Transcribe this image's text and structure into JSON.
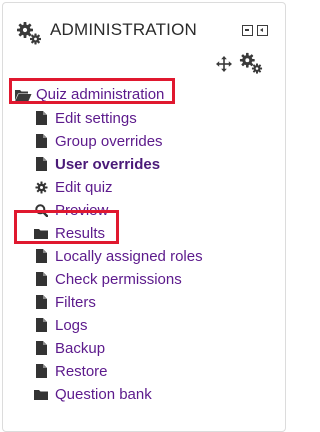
{
  "block": {
    "title": "ADMINISTRATION",
    "header_icon": "gears-icon",
    "controls": [
      "minimize-icon",
      "dock-icon",
      "move-icon",
      "gears-icon"
    ]
  },
  "tree": {
    "root": {
      "label": "Quiz administration",
      "icon": "folder-open-icon"
    },
    "items": [
      {
        "label": "Edit settings",
        "icon": "file-icon",
        "bold": false
      },
      {
        "label": "Group overrides",
        "icon": "file-icon",
        "bold": false
      },
      {
        "label": "User overrides",
        "icon": "file-icon",
        "bold": true
      },
      {
        "label": "Edit quiz",
        "icon": "gear-icon",
        "bold": false
      },
      {
        "label": "Preview",
        "icon": "search-icon",
        "bold": false
      },
      {
        "label": "Results",
        "icon": "folder-icon",
        "bold": false
      },
      {
        "label": "Locally assigned roles",
        "icon": "file-icon",
        "bold": false
      },
      {
        "label": "Check permissions",
        "icon": "file-icon",
        "bold": false
      },
      {
        "label": "Filters",
        "icon": "file-icon",
        "bold": false
      },
      {
        "label": "Logs",
        "icon": "file-icon",
        "bold": false
      },
      {
        "label": "Backup",
        "icon": "file-icon",
        "bold": false
      },
      {
        "label": "Restore",
        "icon": "file-icon",
        "bold": false
      },
      {
        "label": "Question bank",
        "icon": "folder-icon",
        "bold": false
      }
    ]
  },
  "colors": {
    "link": "#5c1a8c",
    "icon": "#333333",
    "highlight": "#e0182f"
  }
}
